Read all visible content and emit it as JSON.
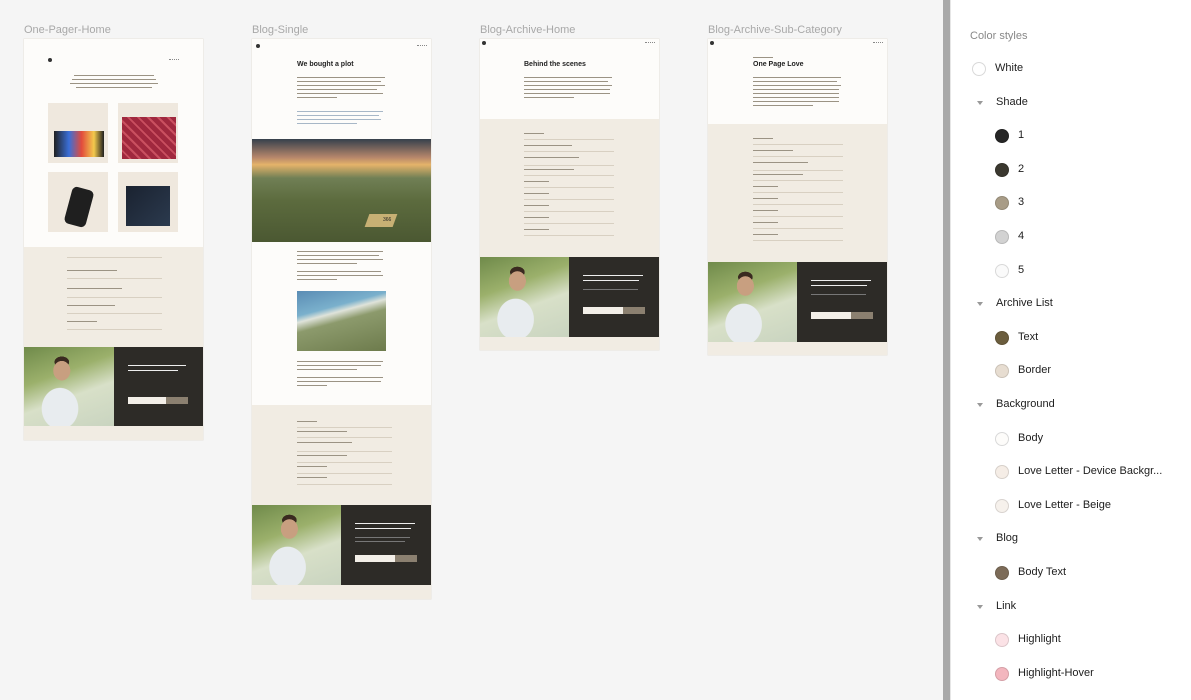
{
  "frames": [
    {
      "label": "One-Pager-Home"
    },
    {
      "label": "Blog-Single"
    },
    {
      "label": "Blog-Archive-Home"
    },
    {
      "label": "Blog-Archive-Sub-Category"
    }
  ],
  "blog_single": {
    "heading": "We bought a plot",
    "badge": "366"
  },
  "archive_home": {
    "heading": "Behind the scenes"
  },
  "archive_sub": {
    "heading": "One Page Love"
  },
  "panel": {
    "title": "Color styles",
    "items": [
      {
        "type": "color",
        "label": "White",
        "color": "#ffffff"
      },
      {
        "type": "group",
        "label": "Shade"
      },
      {
        "type": "color",
        "label": "1",
        "color": "#262626"
      },
      {
        "type": "color",
        "label": "2",
        "color": "#3b382f"
      },
      {
        "type": "color",
        "label": "3",
        "color": "#a89c87"
      },
      {
        "type": "color",
        "label": "4",
        "color": "#d2d2d2"
      },
      {
        "type": "color",
        "label": "5",
        "color": "#fafafa"
      },
      {
        "type": "group",
        "label": "Archive List"
      },
      {
        "type": "color",
        "label": "Text",
        "color": "#6b5d3d"
      },
      {
        "type": "color",
        "label": "Border",
        "color": "#e7ddd1"
      },
      {
        "type": "group",
        "label": "Background"
      },
      {
        "type": "color",
        "label": "Body",
        "color": "#fdfcfa"
      },
      {
        "type": "color",
        "label": "Love Letter - Device Backgr...",
        "color": "#f5ede6"
      },
      {
        "type": "color",
        "label": "Love Letter - Beige",
        "color": "#f6f1ec"
      },
      {
        "type": "group",
        "label": "Blog"
      },
      {
        "type": "color",
        "label": "Body Text",
        "color": "#7c6b58"
      },
      {
        "type": "group",
        "label": "Link"
      },
      {
        "type": "color",
        "label": "Highlight",
        "color": "#fbe2e6"
      },
      {
        "type": "color",
        "label": "Highlight-Hover",
        "color": "#f3b6be"
      }
    ]
  }
}
